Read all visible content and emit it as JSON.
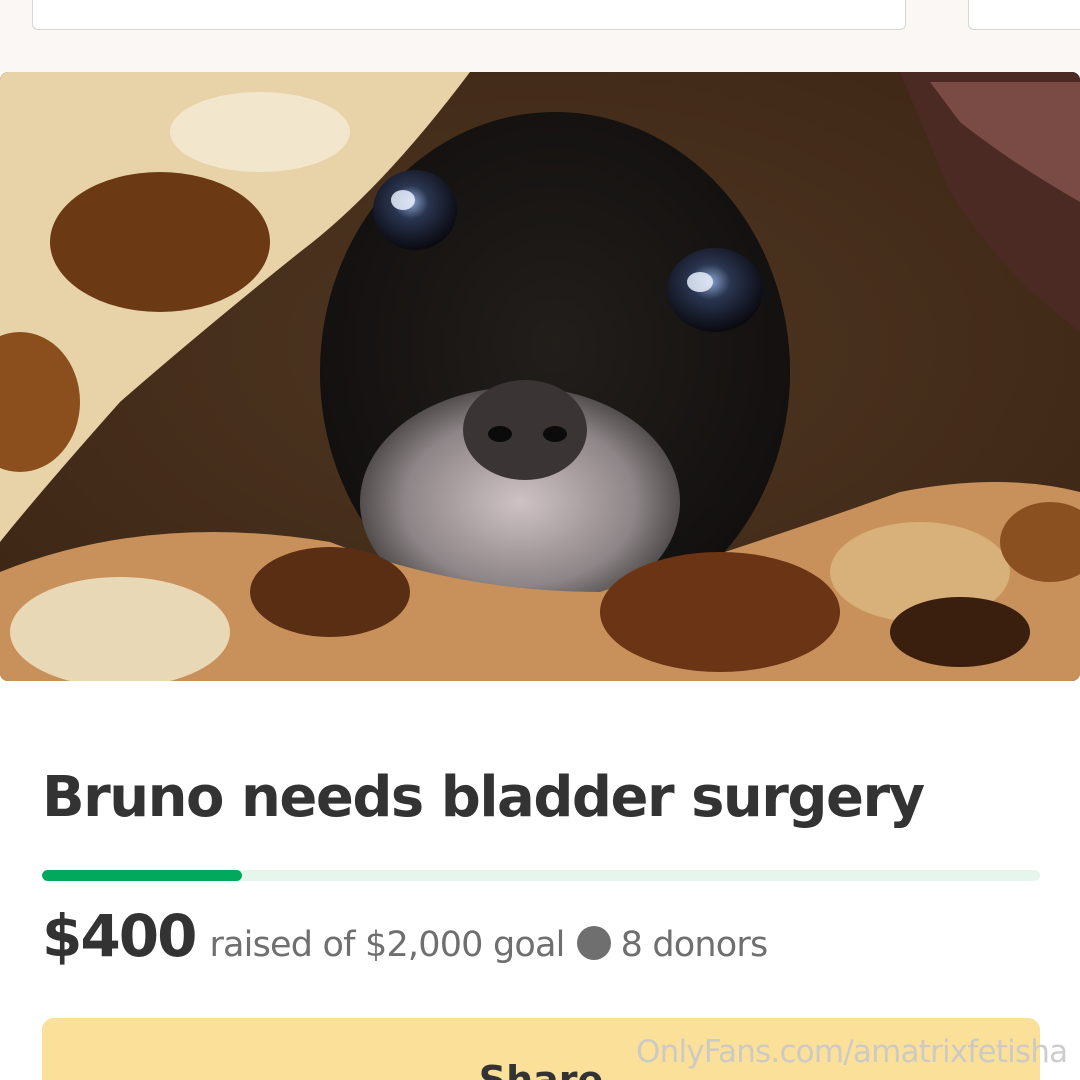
{
  "campaign": {
    "title": "Bruno needs bladder surgery",
    "hero_image_alt": "photo",
    "raised_amount": "$400",
    "raised_text": "raised of $2,000 goal",
    "donors_text": "8 donors",
    "progress_fraction": 0.2
  },
  "actions": {
    "share_label": "Share"
  },
  "watermark": {
    "text": "OnlyFans.com/amatrixfetisha"
  },
  "colors": {
    "progress_fill": "#02a95c",
    "progress_track": "#e6f6ec",
    "share_button": "#fbe09a",
    "title_text": "#333333",
    "secondary_text": "#6f6f6f"
  }
}
